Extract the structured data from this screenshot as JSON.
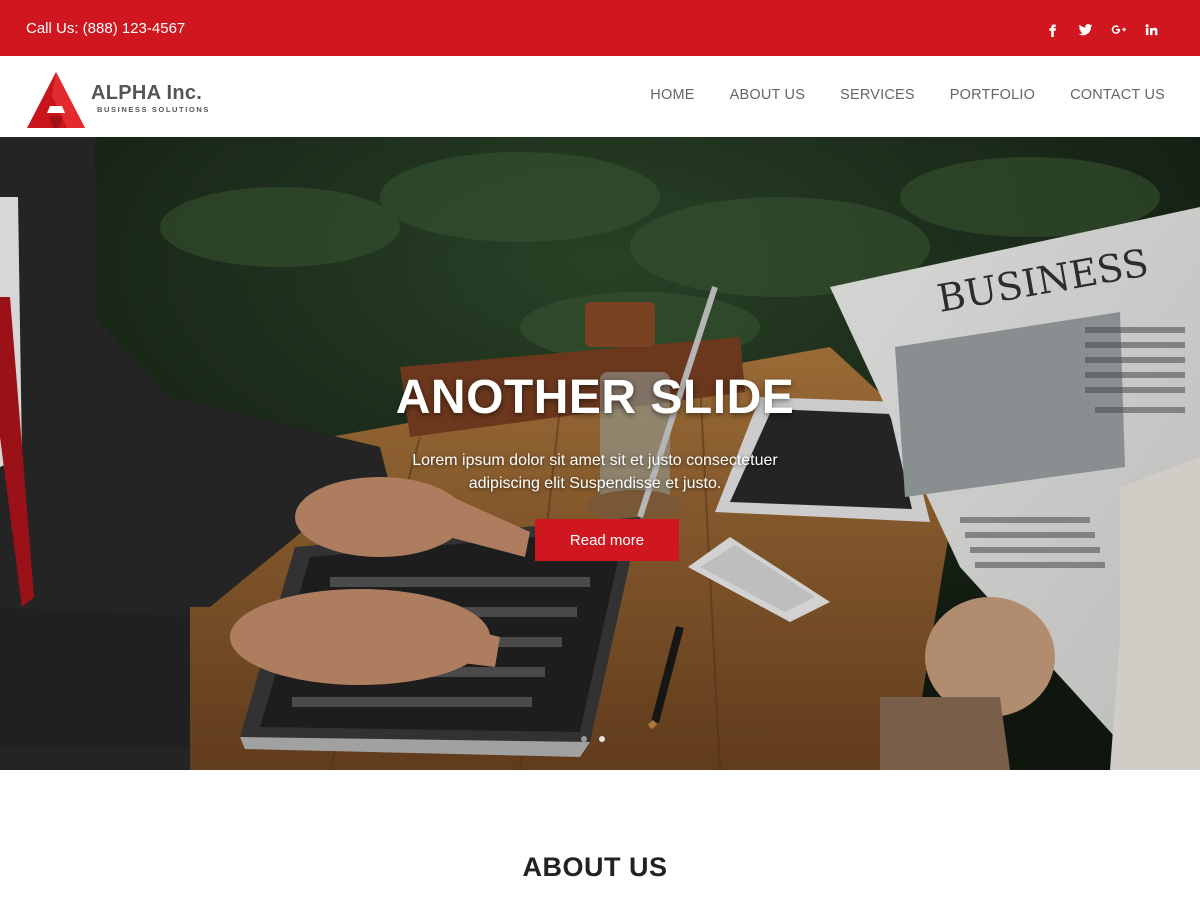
{
  "topbar": {
    "phone": "Call Us: (888) 123-4567",
    "socials": [
      {
        "icon": "facebook-icon",
        "glyph": "f"
      },
      {
        "icon": "twitter-icon",
        "glyph": ""
      },
      {
        "icon": "google-plus-icon",
        "glyph": "g+"
      },
      {
        "icon": "linkedin-icon",
        "glyph": "in"
      }
    ]
  },
  "header": {
    "logo": {
      "name": "ALPHA Inc.",
      "tagline": "BUSINESS SOLUTIONS"
    },
    "nav": [
      "HOME",
      "ABOUT US",
      "SERVICES",
      "PORTFOLIO",
      "CONTACT US"
    ]
  },
  "hero": {
    "title": "ANOTHER SLIDE",
    "text": "Lorem ipsum dolor sit amet sit et justo consectetuer adipiscing elit Suspendisse et justo.",
    "button": "Read more",
    "slide_count": 2,
    "active_slide": 1
  },
  "about": {
    "title": "ABOUT US"
  },
  "colors": {
    "brand_red": "#d0161e",
    "nav_text": "#666666"
  }
}
